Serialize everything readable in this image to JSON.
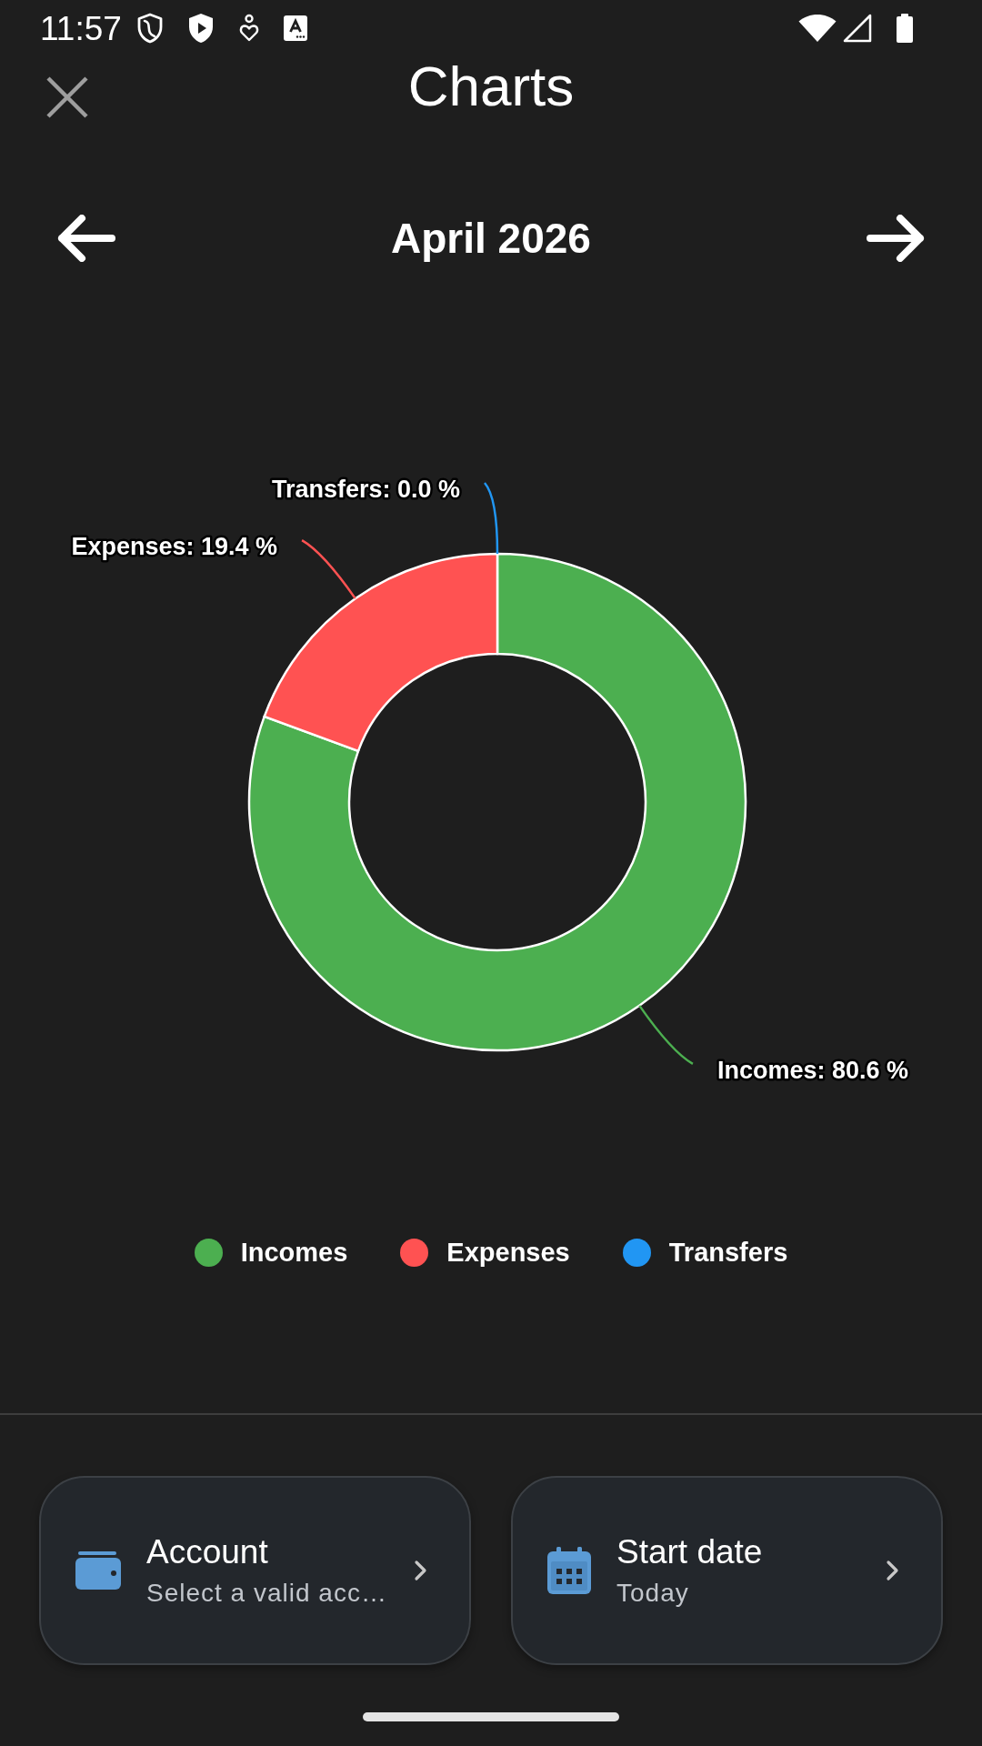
{
  "status_bar": {
    "time": "11:57"
  },
  "header": {
    "title": "Charts"
  },
  "month_nav": {
    "label": "April 2026"
  },
  "chart": {
    "chart_data": {
      "type": "donut",
      "values": [
        80.6,
        19.4,
        0.0
      ],
      "value_labels": [
        "Incomes: 80.6 %",
        "Expenses: 19.4 %",
        "Transfers: 0.0 %"
      ]
    }
  },
  "legend": [
    {
      "label": "Incomes",
      "color": "#4caf50"
    },
    {
      "label": "Expenses",
      "color": "#ff5252"
    },
    {
      "label": "Transfers",
      "color": "#2196f3"
    }
  ],
  "cards": [
    {
      "kind": "account",
      "title": "Account",
      "subtitle": "Select a valid acc…"
    },
    {
      "kind": "date",
      "title": "Start date",
      "subtitle": "Today"
    }
  ]
}
